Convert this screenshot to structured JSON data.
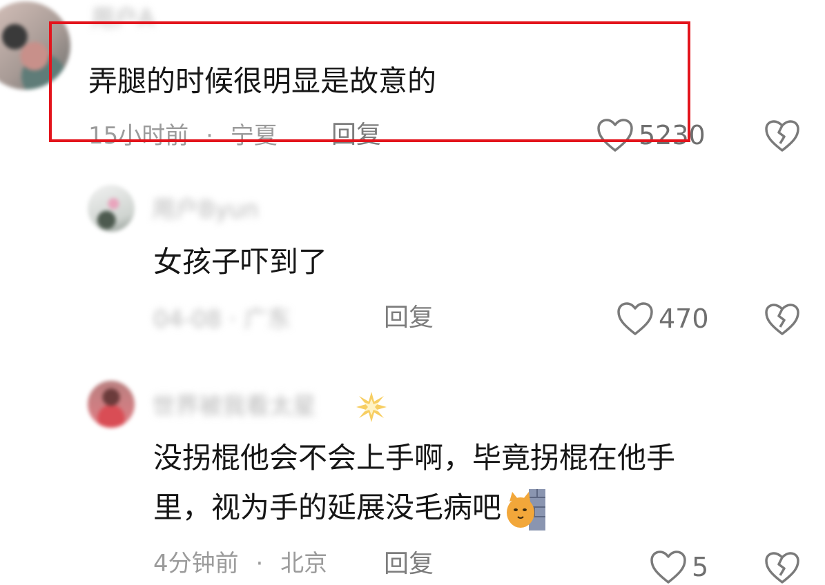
{
  "highlight_color": "#e3141c",
  "comments": [
    {
      "username": "用户A",
      "text": "弄腿的时候很明显是故意的",
      "time": "15小时前",
      "separator": "·",
      "location": "宁夏",
      "reply_label": "回复",
      "likes": "5230",
      "avatar_icon": "user-avatar",
      "like_icon": "heart-outline-icon",
      "dislike_icon": "broken-heart-icon"
    },
    {
      "username": "用户Byun",
      "text": "女孩子吓到了",
      "meta_blurred": "04-08 · 广东",
      "reply_label": "回复",
      "likes": "470",
      "avatar_icon": "user-avatar",
      "like_icon": "heart-outline-icon",
      "dislike_icon": "broken-heart-icon"
    },
    {
      "username": "世界被我看太星",
      "text_line1": "没拐棍他会不会上手啊，毕竟拐棍在他手",
      "text_line2": "里，视为手的延展没毛病吧",
      "time": "4分钟前",
      "separator": "·",
      "location": "北京",
      "reply_label": "回复",
      "likes": "5",
      "avatar_icon": "user-avatar",
      "emoji_icon": "peeking-cat-emoji",
      "username_badge_icon": "collision-burst-icon",
      "like_icon": "heart-outline-icon",
      "dislike_icon": "broken-heart-icon"
    }
  ]
}
